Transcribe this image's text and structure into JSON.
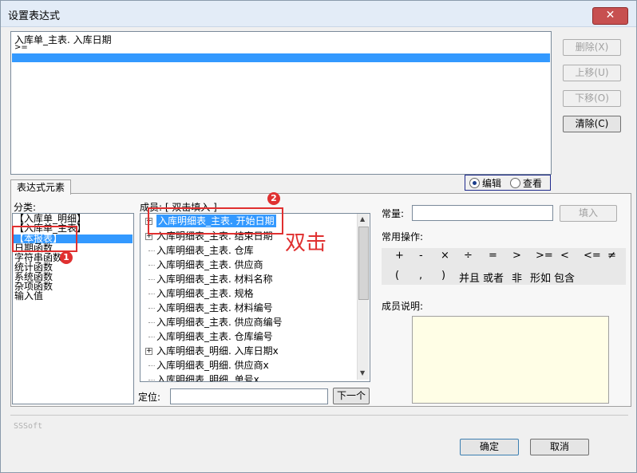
{
  "window": {
    "title": "设置表达式",
    "close_icon": "close-icon"
  },
  "expression": {
    "lines": [
      "入库单_主表. 入库日期",
      ">="
    ],
    "selected_line_index": 2
  },
  "side_buttons": {
    "delete": "删除(X)",
    "move_up": "上移(U)",
    "move_down": "下移(O)",
    "clear": "清除(C)"
  },
  "tab": {
    "label": "表达式元素"
  },
  "mode": {
    "edit": "编辑",
    "view": "查看",
    "selected": "edit"
  },
  "category": {
    "label": "分类:",
    "items": [
      "【入库单_明细】",
      "【入库单_主表】",
      "【本报表】",
      "日期函数",
      "字符串函数",
      "统计函数",
      "系统函数",
      "杂项函数",
      "输入值"
    ],
    "selected_index": 2
  },
  "members": {
    "label": "成员: [ 双击填入 ]",
    "items": [
      {
        "text": "入库明细表_主表. 开始日期",
        "expandable": true,
        "selected": true
      },
      {
        "text": "入库明细表_主表. 结束日期",
        "expandable": true,
        "selected": false
      },
      {
        "text": "入库明细表_主表. 仓库",
        "expandable": false,
        "selected": false
      },
      {
        "text": "入库明细表_主表. 供应商",
        "expandable": false,
        "selected": false
      },
      {
        "text": "入库明细表_主表. 材料名称",
        "expandable": false,
        "selected": false
      },
      {
        "text": "入库明细表_主表. 规格",
        "expandable": false,
        "selected": false
      },
      {
        "text": "入库明细表_主表. 材料编号",
        "expandable": false,
        "selected": false
      },
      {
        "text": "入库明细表_主表. 供应商编号",
        "expandable": false,
        "selected": false
      },
      {
        "text": "入库明细表_主表. 仓库编号",
        "expandable": false,
        "selected": false
      },
      {
        "text": "入库明细表_明细. 入库日期x",
        "expandable": true,
        "selected": false
      },
      {
        "text": "入库明细表_明细. 供应商x",
        "expandable": false,
        "selected": false
      },
      {
        "text": "入库明细表_明细. 单号x",
        "expandable": false,
        "selected": false
      }
    ]
  },
  "locate": {
    "label": "定位:",
    "value": "",
    "next_button": "下一个"
  },
  "constant": {
    "label": "常量:",
    "value": "",
    "fill_button": "填入"
  },
  "common_ops": {
    "label": "常用操作:",
    "row1": [
      "+",
      "-",
      "×",
      "÷",
      "=",
      ">",
      ">=",
      "<",
      "<=",
      "≠"
    ],
    "row2": [
      "(",
      ",",
      ")",
      "并且",
      "或者",
      "非",
      "形如",
      "包含"
    ]
  },
  "member_desc": {
    "label": "成员说明:",
    "value": ""
  },
  "footer": {
    "brand": "SSSoft",
    "ok": "确定",
    "cancel": "取消"
  },
  "annotations": {
    "badge1": "1",
    "badge2": "2",
    "double_click_text": "双击",
    "accent_color": "#e03030"
  }
}
